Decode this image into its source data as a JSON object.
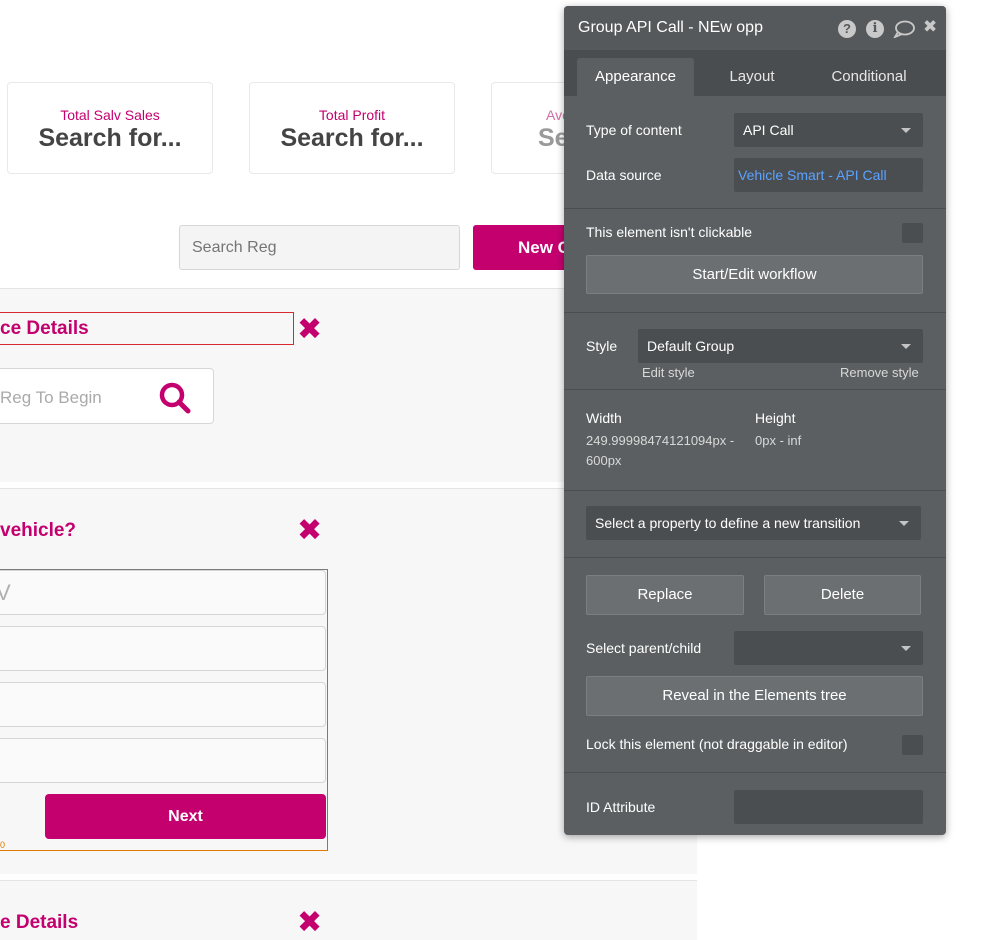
{
  "stat_cards": [
    {
      "title": "Total Salv Sales",
      "value": "Search for..."
    },
    {
      "title": "Total Profit",
      "value": "Search for..."
    },
    {
      "title": "Ave",
      "value": "Se"
    }
  ],
  "toolbar": {
    "search_placeholder": "Search Reg",
    "new_button_label": "New C"
  },
  "sections": {
    "s1_title": "ce Details",
    "s1_reg_placeholder": "Reg To Begin",
    "s2_title": "vehicle?",
    "s2_field_partial": "V",
    "next_label": "Next",
    "s3_title": "e Details",
    "stray_zero": "0"
  },
  "panel": {
    "title": "Group API Call - NEw opp",
    "header_icons": [
      "help-icon",
      "info-icon",
      "comment-icon",
      "close-icon"
    ],
    "tabs": [
      "Appearance",
      "Layout",
      "Conditional"
    ],
    "active_tab": "Appearance",
    "type_of_content_label": "Type of content",
    "type_of_content_value": "API Call",
    "data_source_label": "Data source",
    "data_source_value": "Vehicle Smart - API Call",
    "not_clickable_label": "This element isn't clickable",
    "workflow_button": "Start/Edit workflow",
    "style_label": "Style",
    "style_value": "Default Group",
    "edit_style": "Edit style",
    "remove_style": "Remove style",
    "width_label": "Width",
    "width_value_line1": "249.99998474121094px -",
    "width_value_line2": "600px",
    "height_label": "Height",
    "height_value": "0px - inf",
    "transition_placeholder": "Select a property to define a new transition",
    "replace_button": "Replace",
    "delete_button": "Delete",
    "parent_child_label": "Select parent/child",
    "reveal_button": "Reveal in the Elements tree",
    "lock_label": "Lock this element (not draggable in editor)",
    "id_attribute_label": "ID Attribute"
  },
  "colors": {
    "brand": "#c4006f",
    "panel_bg": "#5b5f61",
    "link": "#5aa2ff"
  }
}
